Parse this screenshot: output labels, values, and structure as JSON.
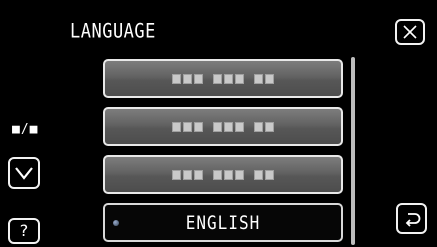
{
  "header": {
    "title": "LANGUAGE"
  },
  "left_panel": {
    "page_indicator": "■/■"
  },
  "buttons": {
    "help_label": "?",
    "close_icon": "close-icon",
    "down_icon": "chevron-down-icon",
    "back_icon": "return-arrow-icon"
  },
  "language_list": {
    "items": [
      {
        "label": "",
        "selected": false
      },
      {
        "label": "",
        "selected": false
      },
      {
        "label": "",
        "selected": false
      },
      {
        "label": "ENGLISH",
        "selected": true
      }
    ]
  },
  "colors": {
    "background": "#000000",
    "item_fill": "#626262",
    "item_border": "#e8e8e8",
    "selected_fill": "#060606"
  }
}
